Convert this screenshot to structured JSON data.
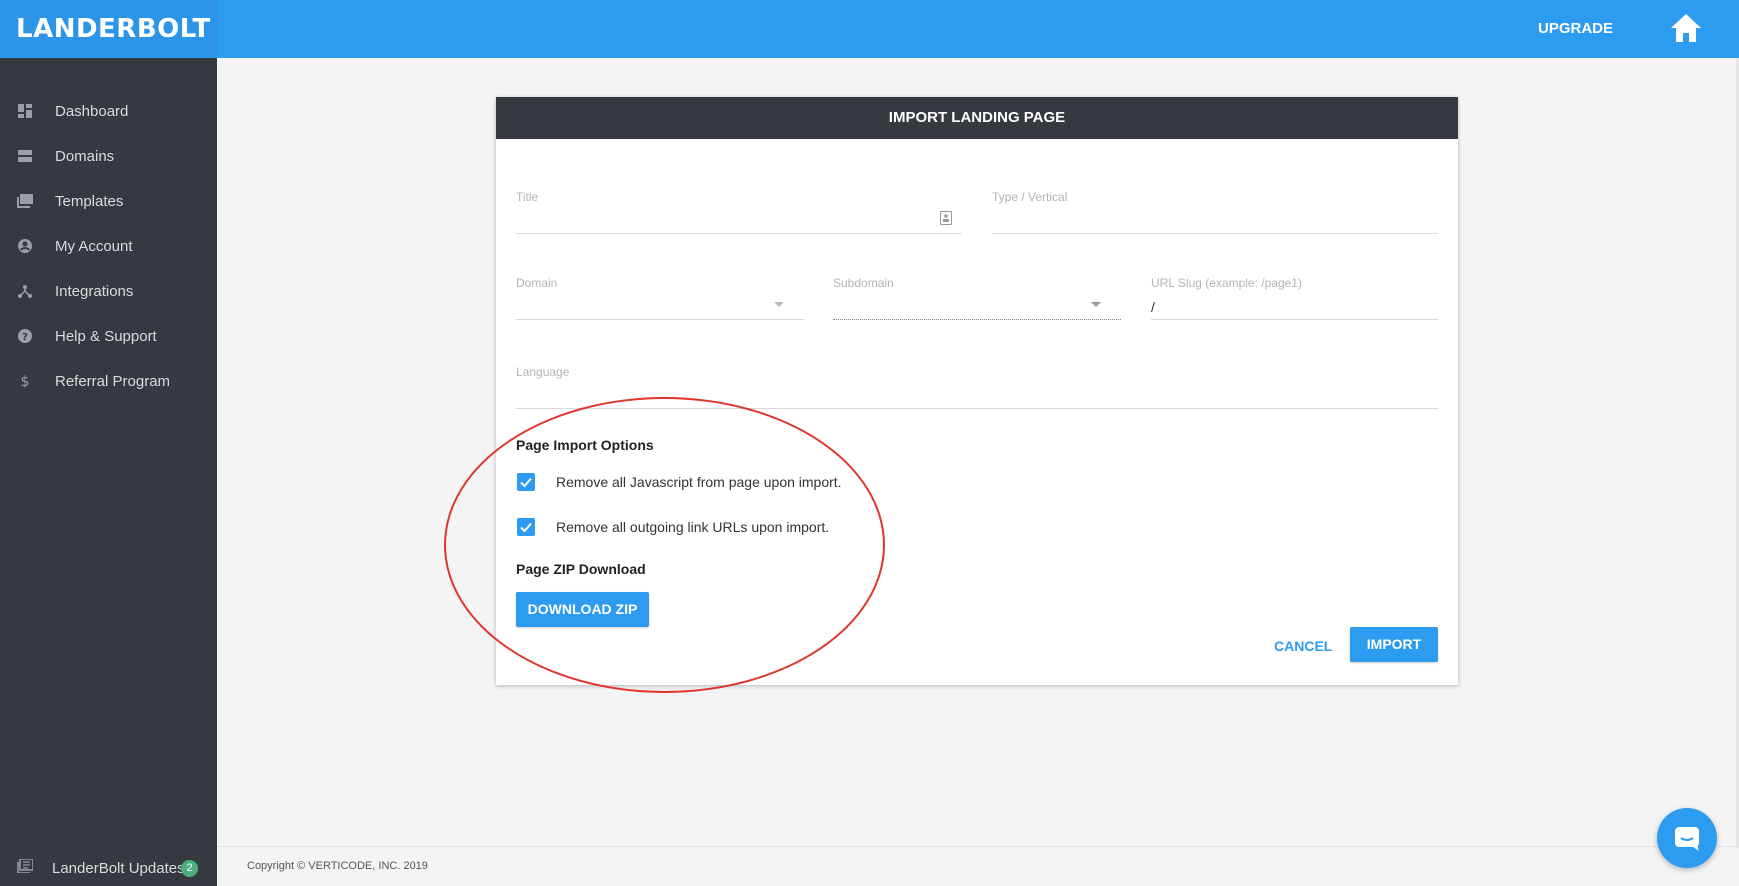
{
  "app": {
    "logo_text": "LANDERBOLT",
    "brand_color": "#2d9bf0",
    "upgrade_label": "UPGRADE"
  },
  "sidebar": {
    "items": [
      {
        "label": "Dashboard",
        "icon": "dashboard-icon"
      },
      {
        "label": "Domains",
        "icon": "domains-icon"
      },
      {
        "label": "Templates",
        "icon": "templates-icon"
      },
      {
        "label": "My Account",
        "icon": "account-icon"
      },
      {
        "label": "Integrations",
        "icon": "integrations-icon"
      },
      {
        "label": "Help & Support",
        "icon": "help-icon"
      },
      {
        "label": "Referral Program",
        "icon": "dollar-icon"
      }
    ],
    "updates": {
      "label": "LanderBolt Updates",
      "count": "2"
    }
  },
  "dialog": {
    "title": "IMPORT LANDING PAGE",
    "fields": {
      "title_label": "Title",
      "type_label": "Type / Vertical",
      "domain_label": "Domain",
      "subdomain_label": "Subdomain",
      "slug_label": "URL Slug (example: /page1)",
      "slug_value": "/",
      "language_label": "Language"
    },
    "import_options": {
      "heading": "Page Import Options",
      "options": [
        {
          "label": "Remove all Javascript from page upon import.",
          "checked": true
        },
        {
          "label": "Remove all outgoing link URLs upon import.",
          "checked": true
        }
      ]
    },
    "zip": {
      "heading": "Page ZIP Download",
      "button_label": "DOWNLOAD ZIP"
    },
    "cancel_label": "CANCEL",
    "import_label": "IMPORT"
  },
  "footer": {
    "prefix": "Copyright © ",
    "company": "VERTICODE, INC.",
    "year": " 2019"
  },
  "annotation_color": "#e0352b"
}
